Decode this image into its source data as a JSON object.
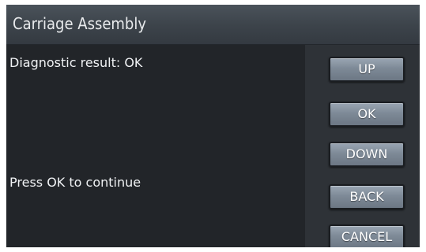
{
  "header": {
    "title": "Carriage Assembly"
  },
  "content": {
    "result_text": "Diagnostic result: OK",
    "instruction_text": "Press OK to continue"
  },
  "buttons": {
    "up": "UP",
    "ok": "OK",
    "down": "DOWN",
    "back": "BACK",
    "cancel": "CANCEL"
  },
  "colors": {
    "title_bar": "#3c434a",
    "content_background": "#222529",
    "button_background": "#7e8a97",
    "text": "#f0f2f4"
  }
}
